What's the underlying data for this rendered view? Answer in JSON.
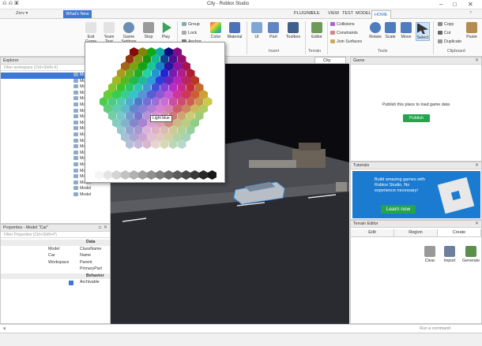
{
  "window": {
    "title": "City - Roblox Studio",
    "user": "Zerv",
    "whats_new": "What's New",
    "controls": [
      "–",
      "□",
      "✕"
    ]
  },
  "menu_tabs": [
    "FILE",
    "HOME",
    "MODEL",
    "TEST",
    "VIEW",
    "PLUGINS"
  ],
  "active_tab": "HOME",
  "ribbon": {
    "clipboard": {
      "group": "Clipboard",
      "paste": "Paste",
      "copy": "Copy",
      "cut": "Cut",
      "duplicate": "Duplicate"
    },
    "tools": {
      "group": "Tools",
      "select": "Select",
      "move": "Move",
      "scale": "Scale",
      "rotate": "Rotate",
      "collisions": "Collisions",
      "constraints": "Constraints",
      "join_surfaces": "Join Surfaces"
    },
    "terrain": {
      "group": "Terrain",
      "editor": "Editor"
    },
    "insert": {
      "group": "Insert",
      "toolbox": "Toolbox",
      "part": "Part",
      "ui": "UI"
    },
    "edit": {
      "material": "Material",
      "color": "Color",
      "group_btn": "Group",
      "lock": "Lock",
      "anchor": "Anchor"
    },
    "test": {
      "play": "Play",
      "stop": "Stop",
      "game_settings": "Game Settings",
      "team_test": "Team Test",
      "exit_game": "Exit Game"
    }
  },
  "explorer": {
    "title": "Explorer",
    "filter_placeholder": "Filter workspace (Ctrl+Shift+X)",
    "rows": [
      "Model",
      "Model",
      "Model",
      "Model",
      "Model",
      "Model",
      "Model",
      "Model",
      "Model",
      "Model",
      "Model",
      "Model",
      "Model",
      "Model",
      "Model",
      "Model",
      "Model",
      "Model",
      "Model",
      "Model",
      "Model"
    ]
  },
  "properties": {
    "title": "Properties - Model \"Car\"",
    "filter_placeholder": "Filter Properties (Ctrl+Shift+P)",
    "sections": [
      {
        "name": "Data",
        "rows": [
          [
            "ClassName",
            "Model"
          ],
          [
            "Name",
            "Car"
          ],
          [
            "Parent",
            "Workspace"
          ],
          [
            "PrimaryPart",
            ""
          ]
        ]
      },
      {
        "name": "Behavior",
        "rows": [
          [
            "Archivable",
            ""
          ]
        ]
      }
    ]
  },
  "viewport": {
    "tab": "City",
    "tooltip": "Light blue"
  },
  "game_panel": {
    "title": "Game",
    "message": "Publish this place to load game data",
    "button": "Publish"
  },
  "tutorials_panel": {
    "title": "Tutorials",
    "text": "Build amazing games with Roblox Studio. No experience necessary!",
    "button": "Learn now"
  },
  "terrain_panel": {
    "title": "Terrain Editor",
    "tabs": [
      "Create",
      "Region",
      "Edit"
    ],
    "tools": [
      "Generate",
      "Import",
      "Clear"
    ]
  },
  "command_bar": {
    "placeholder": "Run a command"
  },
  "colors": {
    "accent": "#3c78d8",
    "green": "#24a44c"
  }
}
